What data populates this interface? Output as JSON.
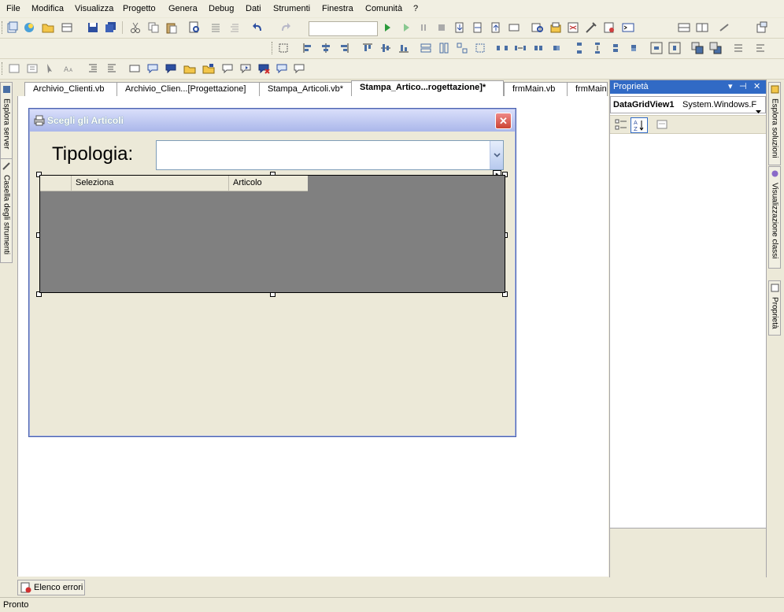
{
  "menu": [
    "File",
    "Modifica",
    "Visualizza",
    "Progetto",
    "Genera",
    "Debug",
    "Dati",
    "Strumenti",
    "Finestra",
    "Comunità",
    "?"
  ],
  "side_tabs_left": [
    "Esplora server",
    "Casella degli strumenti"
  ],
  "side_tabs_right": [
    "Esplora soluzioni",
    "Visualizzazione classi",
    "Proprietà"
  ],
  "document_tabs": [
    {
      "label": "Archivio_Clienti.vb",
      "active": false
    },
    {
      "label": "Archivio_Clien...[Progettazione]",
      "active": false
    },
    {
      "label": "Stampa_Articoli.vb*",
      "active": false
    },
    {
      "label": "Stampa_Artico...rogettazione]*",
      "active": true
    },
    {
      "label": "frmMain.vb",
      "active": false
    },
    {
      "label": "frmMain",
      "active": false
    }
  ],
  "form": {
    "title": "Scegli gli Articoli",
    "close_glyph": "✕",
    "tipologia_label": "Tipologia:",
    "tipologia_value": "",
    "grid_columns": [
      "Seleziona",
      "Articolo"
    ]
  },
  "properties": {
    "title": "Proprietà",
    "object_name": "DataGridView1",
    "object_type": "System.Windows.F",
    "title_buttons": [
      "▾",
      "⊣",
      "✕"
    ]
  },
  "bottom_tab": "Elenco errori",
  "status": "Pronto",
  "colors": {
    "title_active": "#316ac5",
    "form_border": "#4b62b0",
    "grid_bg": "#808080",
    "chrome": "#ece9d8"
  }
}
